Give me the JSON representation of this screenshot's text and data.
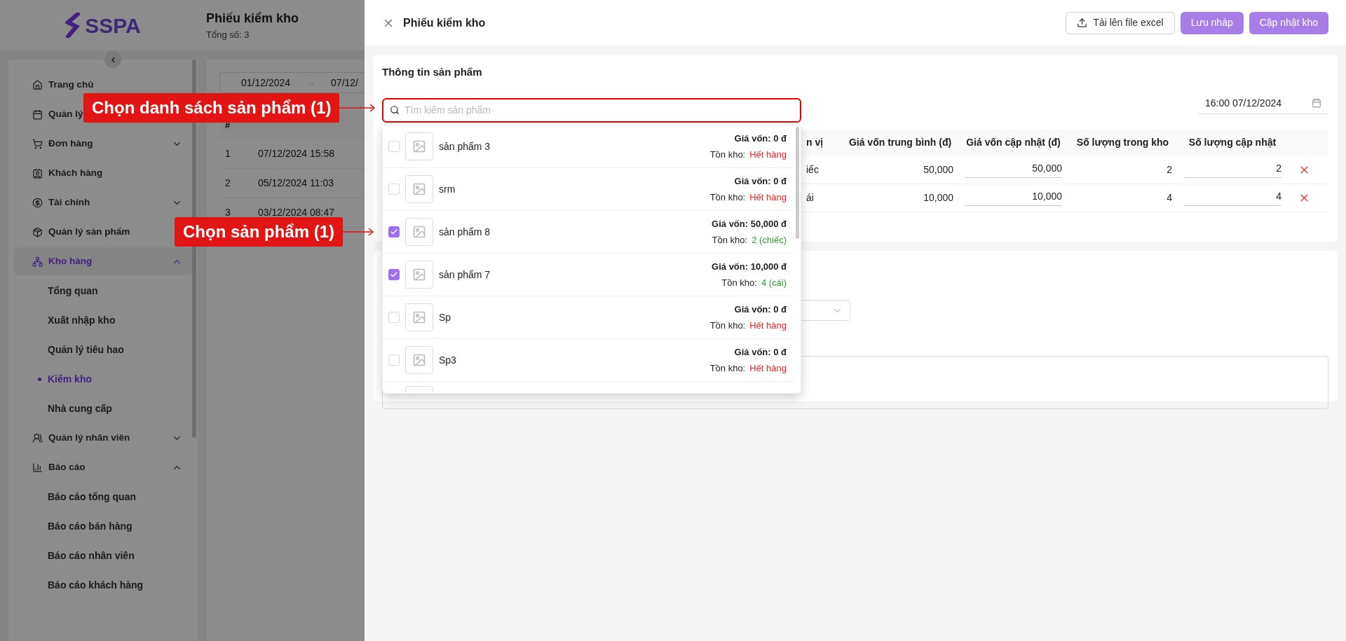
{
  "sidebar": {
    "logo": "SSPA",
    "items": [
      {
        "label": "Trang chủ",
        "selected": false
      },
      {
        "label": "Quản lý",
        "selected": false
      },
      {
        "label": "Đơn hàng",
        "selected": false,
        "expanded": false
      },
      {
        "label": "Khách hàng",
        "selected": false
      },
      {
        "label": "Tài chính",
        "selected": false,
        "expanded": false
      },
      {
        "label": "Quản lý sản phẩm",
        "selected": false
      },
      {
        "label": "Kho hàng",
        "selected": true,
        "expanded": true,
        "children": [
          {
            "label": "Tổng quan",
            "selected": false
          },
          {
            "label": "Xuất nhập kho",
            "selected": false
          },
          {
            "label": "Quản lý tiêu hao",
            "selected": false
          },
          {
            "label": "Kiểm kho",
            "selected": true
          },
          {
            "label": "Nhà cung cấp",
            "selected": false
          }
        ]
      },
      {
        "label": "Quản lý nhân viên",
        "selected": false,
        "expanded": false
      },
      {
        "label": "Báo cáo",
        "selected": false,
        "expanded": true,
        "children": [
          {
            "label": "Báo cáo tổng quan",
            "selected": false
          },
          {
            "label": "Báo cáo bán hàng",
            "selected": false
          },
          {
            "label": "Báo cáo nhân viên",
            "selected": false
          },
          {
            "label": "Báo cáo khách hàng",
            "selected": false
          }
        ]
      }
    ]
  },
  "page": {
    "title": "Phiếu kiểm kho",
    "total": "Tổng số: 3",
    "date_from": "01/12/2024",
    "date_separator": "→",
    "date_to": "07/12/",
    "table": {
      "columns": [
        "#"
      ],
      "rows": [
        [
          "1",
          "07/12/2024 15:58"
        ],
        [
          "2",
          "05/12/2024 11:03"
        ],
        [
          "3",
          "03/12/2024 08:47"
        ]
      ]
    }
  },
  "drawer": {
    "title": "Phiếu kiểm kho",
    "buttons": [
      {
        "label": "Tải lên file excel",
        "kind": "outline"
      },
      {
        "label": "Lưu nháp",
        "kind": "primary"
      },
      {
        "label": "Cập nhật kho",
        "kind": "primary"
      }
    ],
    "section_title": "Thông tin sản phẩm",
    "search": {
      "placeholder": "Tìm kiếm sản phẩm"
    },
    "date": "16:00 07/12/2024",
    "table": {
      "columns": [
        "n vị",
        "Giá vốn trung bình (đ)",
        "Giá vốn cập nhật (đ)",
        "Số lượng trong kho",
        "Số lượng cập nhật"
      ],
      "rows": [
        {
          "unit": "iếc",
          "avg_cost": "50,000",
          "new_cost": "50,000",
          "stock": "2",
          "new_qty": "2"
        },
        {
          "unit": "ái",
          "avg_cost": "10,000",
          "new_cost": "10,000",
          "stock": "4",
          "new_qty": "4"
        }
      ]
    },
    "dropdown": [
      {
        "name": "sản phẩm 3",
        "checked": false,
        "price": "Giá vốn: 0 đ",
        "stock_label": "Tồn kho:",
        "stock": "Hết hàng",
        "in_stock": false
      },
      {
        "name": "srm",
        "checked": false,
        "price": "Giá vốn: 0 đ",
        "stock_label": "Tồn kho:",
        "stock": "Hết hàng",
        "in_stock": false
      },
      {
        "name": "sản phẩm 8",
        "checked": true,
        "price": "Giá vốn: 50,000 đ",
        "stock_label": "Tồn kho:",
        "stock": "2 (chiếc)",
        "in_stock": true
      },
      {
        "name": "sản phẩm 7",
        "checked": true,
        "price": "Giá vốn: 10,000 đ",
        "stock_label": "Tồn kho:",
        "stock": "4 (cái)",
        "in_stock": true
      },
      {
        "name": "Sp",
        "checked": false,
        "price": "Giá vốn: 0 đ",
        "stock_label": "Tồn kho:",
        "stock": "Hết hàng",
        "in_stock": false
      },
      {
        "name": "Sp3",
        "checked": false,
        "price": "Giá vốn: 0 đ",
        "stock_label": "Tồn kho:",
        "stock": "Hết hàng",
        "in_stock": false
      }
    ]
  },
  "annotations": [
    "Chọn danh sách sản phẩm (1)",
    "Chọn sản phẩm (1)"
  ]
}
